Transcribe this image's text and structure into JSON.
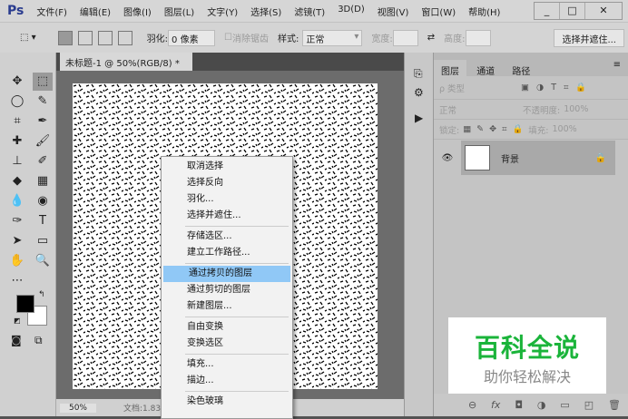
{
  "app": {
    "logo": "Ps"
  },
  "menu": [
    "文件(F)",
    "编辑(E)",
    "图像(I)",
    "图层(L)",
    "文字(Y)",
    "选择(S)",
    "滤镜(T)",
    "3D(D)",
    "视图(V)",
    "窗口(W)",
    "帮助(H)"
  ],
  "window_buttons": [
    "_",
    "□",
    "✕"
  ],
  "options": {
    "feather_label": "羽化:",
    "feather_value": "0 像素",
    "antialias": "消除锯齿",
    "style_label": "样式:",
    "style_value": "正常",
    "width_label": "宽度:",
    "height_label": "高度:",
    "select_mask": "选择并遮住..."
  },
  "document": {
    "tab_title": "未标题-1 @ 50%(RGB/8) *",
    "close": "×",
    "zoom": "50%",
    "doc_info": "文档:1.83"
  },
  "tools": [
    "✥",
    "⬚",
    "◯",
    "✎",
    "⌗",
    "✒",
    "✚",
    "🖌",
    "⊥",
    "✐",
    "◆",
    "▦",
    "💧",
    "◉",
    "✑",
    "T",
    "➤",
    "▭",
    "✋",
    "🔍",
    "⋯"
  ],
  "layers_panel": {
    "tabs": [
      "图层",
      "通道",
      "路径"
    ],
    "filter": "ρ 类型",
    "blend": "正常",
    "opacity_label": "不透明度:",
    "opacity": "100%",
    "lock_label": "锁定:",
    "fill_label": "填充:",
    "fill": "100%",
    "layer_name": "背景"
  },
  "context_menu": {
    "groups": [
      [
        "取消选择",
        "选择反向",
        "羽化...",
        "选择并遮住..."
      ],
      [
        "存储选区...",
        "建立工作路径..."
      ],
      [
        "通过拷贝的图层",
        "通过剪切的图层",
        "新建图层..."
      ],
      [
        "自由变换",
        "变换选区"
      ],
      [
        "填充...",
        "描边..."
      ],
      [
        "染色玻璃"
      ]
    ],
    "highlighted": "通过拷贝的图层"
  },
  "watermark": {
    "title": "百科全说",
    "subtitle": "助你轻松解决"
  },
  "colors": {
    "highlight": "#90c8f6",
    "watermark_green": "#1ab43a",
    "ps_blue": "#2a3c8f"
  }
}
